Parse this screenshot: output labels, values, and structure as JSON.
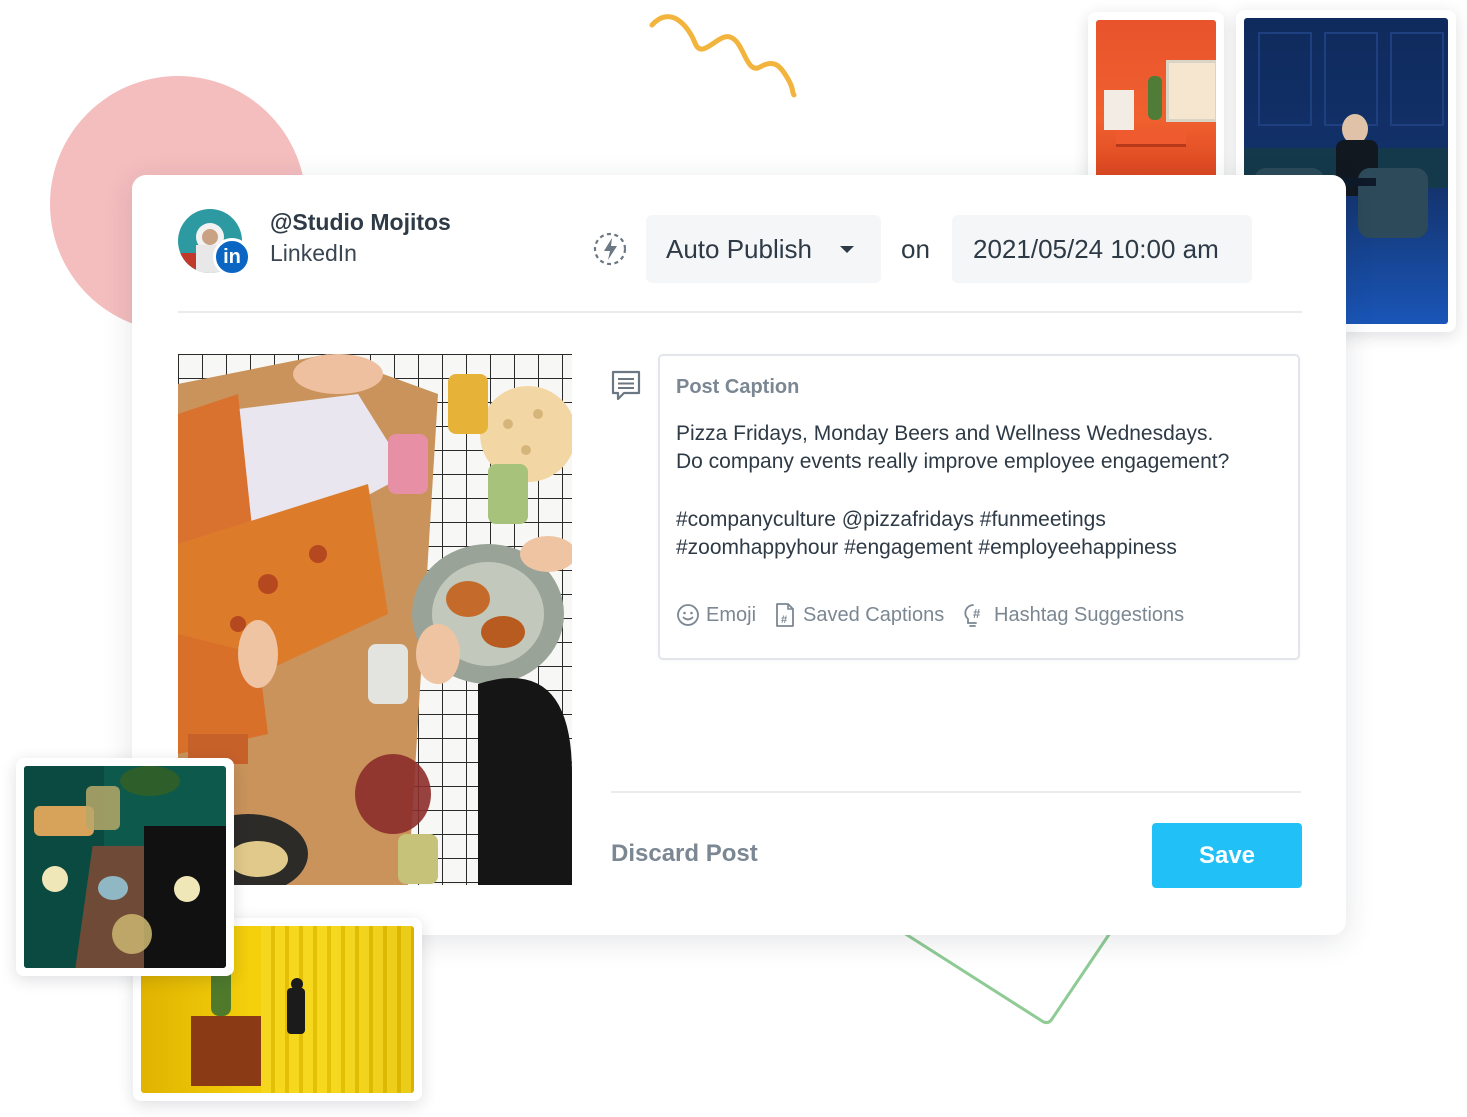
{
  "account": {
    "handle": "@Studio Mojitos",
    "network": "LinkedIn",
    "badge": "in"
  },
  "publish": {
    "mode": "Auto Publish",
    "on_label": "on",
    "datetime": "2021/05/24 10:00 am"
  },
  "caption": {
    "title": "Post Caption",
    "lines": [
      "Pizza Fridays, Monday Beers and Wellness Wednesdays.",
      "Do company events really improve employee engagement?",
      "",
      "#companyculture @pizzafridays #funmeetings",
      "#zoomhappyhour #engagement #employeehappiness"
    ],
    "tools": {
      "emoji": "Emoji",
      "saved_captions": "Saved Captions",
      "hashtag_suggestions": "Hashtag Suggestions"
    }
  },
  "actions": {
    "discard": "Discard Post",
    "save": "Save"
  },
  "colors": {
    "save_button": "#21c0f7",
    "linkedin": "#0a66c2",
    "pink_shape": "#f4bdbe",
    "squiggle": "#f2b43c",
    "green_line": "#8fcb94"
  }
}
